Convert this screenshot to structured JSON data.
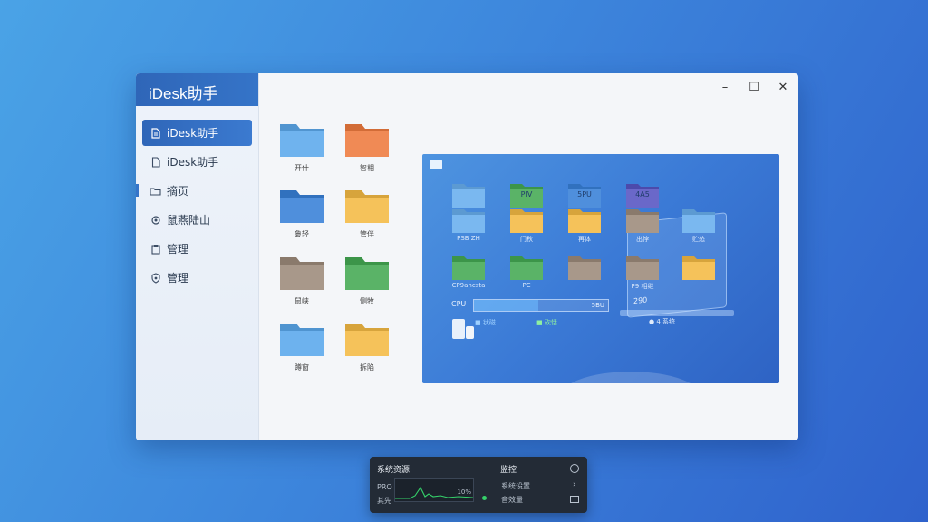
{
  "app": {
    "title": "iDesk助手"
  },
  "window_controls": {
    "minimize": "–",
    "maximize": "☐",
    "close": "✕"
  },
  "sidebar": {
    "items": [
      {
        "label": "iDesk助手",
        "icon": "document-icon",
        "active": true
      },
      {
        "label": "iDesk助手",
        "icon": "file-icon",
        "active": false
      },
      {
        "label": "摘页",
        "icon": "folder-outline-icon",
        "active": false
      },
      {
        "label": "鼠燕陆山",
        "icon": "gear-icon",
        "active": false
      },
      {
        "label": "管理",
        "icon": "clipboard-icon",
        "active": false
      },
      {
        "label": "管理",
        "icon": "shield-gear-icon",
        "active": false
      }
    ]
  },
  "folders": [
    {
      "label": "开什",
      "color": "#6fb3ee"
    },
    {
      "label": "智相",
      "color": "#f08a55"
    },
    {
      "label": "夐轻",
      "color": "#4f8fdc"
    },
    {
      "label": "管伴",
      "color": "#f5c25a"
    },
    {
      "label": "鼠峡",
      "color": "#a8988a"
    },
    {
      "label": "恻牧",
      "color": "#5ab367"
    },
    {
      "label": "蹲窗",
      "color": "#6db2ee"
    },
    {
      "label": "拆陷",
      "color": "#f5c25a"
    }
  ],
  "preview": {
    "folders": [
      {
        "inner": "",
        "label": "",
        "color": "#7ab8f0"
      },
      {
        "inner": "PIV",
        "label": "",
        "color": "#5ab367"
      },
      {
        "inner": "5PU",
        "label": "",
        "color": "#4f8fdc"
      },
      {
        "inner": "4A5",
        "label": "",
        "color": "#6a68c9"
      },
      {
        "inner": "",
        "label": "PSB ZH",
        "color": "#7ab8f0"
      },
      {
        "inner": "",
        "label": "门秋",
        "color": "#f5c25a"
      },
      {
        "inner": "",
        "label": "再体",
        "color": "#f5c25a"
      },
      {
        "inner": "",
        "label": "出悖",
        "color": "#a8988a"
      },
      {
        "inner": "",
        "label": "贮怂",
        "color": "#7ab8f0"
      },
      {
        "inner": "",
        "label": "CP9ancsta",
        "color": "#5ab367"
      },
      {
        "inner": "",
        "label": "PC",
        "color": "#5ab367"
      },
      {
        "inner": "",
        "label": "",
        "color": "#a8988a"
      },
      {
        "inner": "",
        "label": "P9 相继",
        "color": "#a8988a"
      },
      {
        "inner": "",
        "label": "",
        "color": "#f5c25a"
      }
    ],
    "cpu": {
      "label": "CPU",
      "value_text": "5BU",
      "fill_fraction": 0.48
    },
    "laptop_text": "290",
    "legend": [
      "■ 状磁",
      "■ 砍恬"
    ],
    "bottom_right": "● 4 系统"
  },
  "panel": {
    "title_left": "系统资源",
    "title_right": "监控",
    "row1_label": "PRO",
    "row2_label": "其先",
    "graph_value": "10%",
    "menu1": "系统设置",
    "menu2": "音效量",
    "colors": {
      "graph_line": "#35d16a"
    }
  }
}
